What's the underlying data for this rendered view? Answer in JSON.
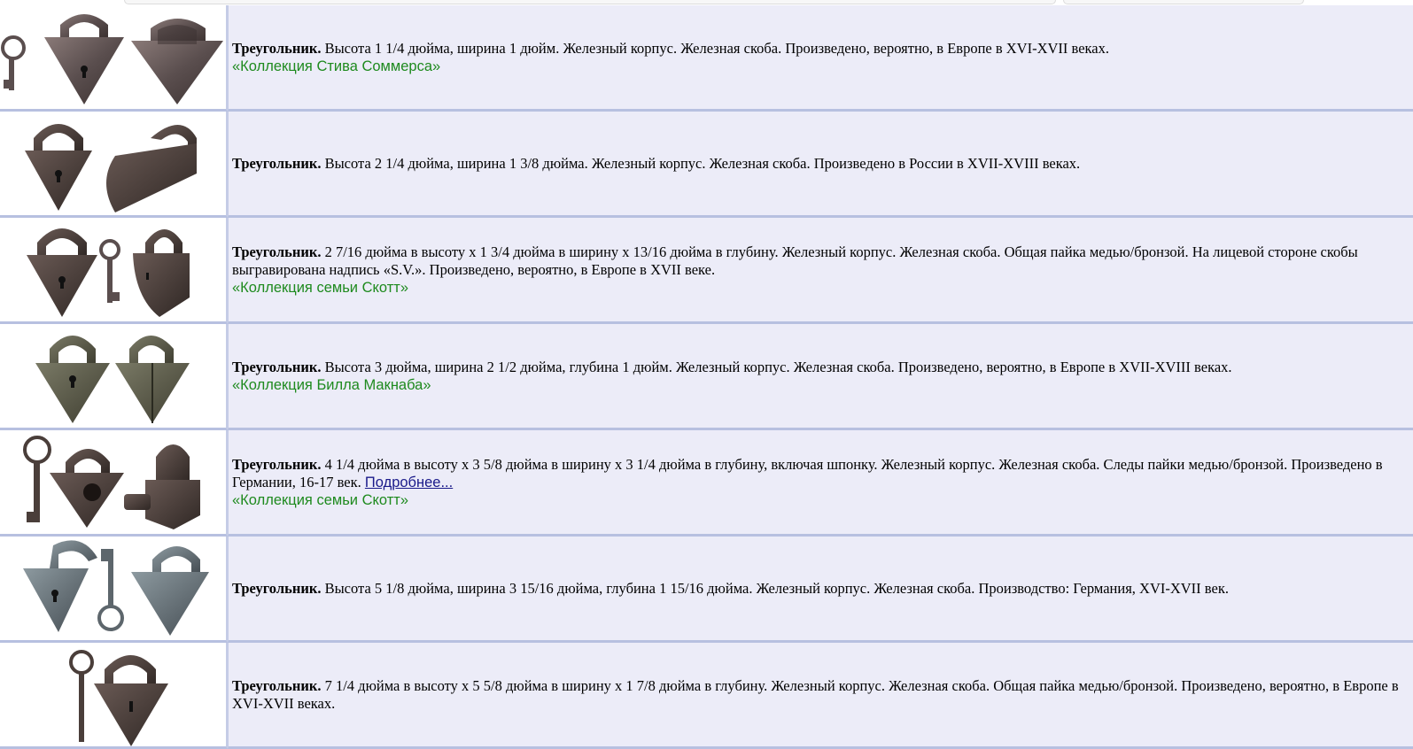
{
  "rows": [
    {
      "title": "Треугольник.",
      "desc": " Высота 1 1/4 дюйма, ширина 1 дюйм. Железный корпус. Железная скоба. Произведено, вероятно, в Европе в XVI-XVII веках.",
      "collection": "«Коллекция Стива Соммерса»"
    },
    {
      "title": "Треугольник.",
      "desc": " Высота 2 1/4 дюйма, ширина 1 3/8 дюйма. Железный корпус. Железная скоба. Произведено в России в XVII-XVIII веках."
    },
    {
      "title": "Треугольник.",
      "desc": " 2 7/16 дюйма в высоту x 1 3/4 дюйма в ширину x 13/16 дюйма в глубину. Железный корпус. Железная скоба. Общая пайка медью/бронзой. На лицевой стороне скобы выгравирована надпись «S.V.». Произведено, вероятно, в Европе в XVII веке.",
      "collection": "«Коллекция семьи Скотт»"
    },
    {
      "title": "Треугольник.",
      "desc": " Высота 3 дюйма, ширина 2 1/2 дюйма, глубина 1 дюйм. Железный корпус. Железная скоба. Произведено, вероятно, в Европе в XVII-XVIII веках.",
      "collection": "«Коллекция Билла Макнаба»"
    },
    {
      "title": "Треугольник.",
      "desc": " 4 1/4 дюйма в высоту x 3 5/8 дюйма в ширину x 3 1/4 дюйма в глубину, включая шпонку. Железный корпус. Железная скоба. Следы пайки медью/бронзой. Произведено в Германии, 16-17 век. ",
      "more": "Подробнее...",
      "collection": "«Коллекция семьи Скотт»"
    },
    {
      "title": "Треугольник.",
      "desc": " Высота 5 1/8 дюйма, ширина 3 15/16 дюйма, глубина 1 15/16 дюйма. Железный корпус. Железная скоба. Производство: Германия, XVI-XVII век."
    },
    {
      "title": "Треугольник.",
      "desc": " 7 1/4 дюйма в высоту x 5 5/8 дюйма в ширину x 1 7/8 дюйма в глубину. Железный корпус. Железная скоба. Общая пайка медью/бронзой. Произведено, вероятно, в Европе в XVI-XVII веках."
    }
  ],
  "colors": {
    "row_bg": "#ececf8",
    "border": "#b7c0e0",
    "collection": "#1e8a1e",
    "link": "#1a1a8a"
  }
}
